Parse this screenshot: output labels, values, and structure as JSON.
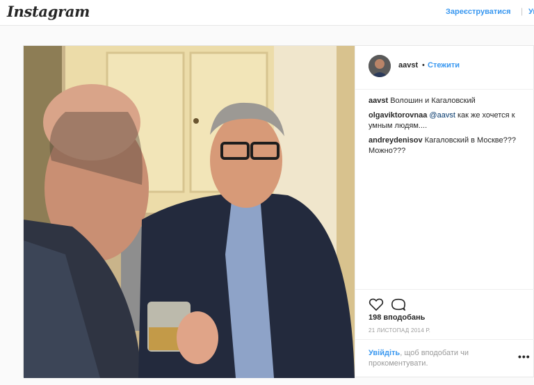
{
  "header": {
    "logo": "Instagram",
    "register_label": "Зареєструватися",
    "separator": "|",
    "login_label": "Увійти"
  },
  "post": {
    "photo_icon": "post-photo",
    "username": "aavst",
    "dot": "•",
    "follow_label": "Стежити",
    "comments": [
      {
        "user": "aavst",
        "mention": "",
        "text": "Волошин и Кагаловский"
      },
      {
        "user": "olgaviktorovnaa",
        "mention": "@aavst",
        "text": "как же хочется к умным людям...."
      },
      {
        "user": "andreydenisov",
        "mention": "",
        "text": "Кагаловский в Москве??? Можно???"
      }
    ],
    "likes": "198 вподобань",
    "date": "21 ЛИСТОПАД 2014 Р.",
    "login_prompt_link": "Увійдіть",
    "login_prompt_rest": ", щоб вподобати чи прокоментувати.",
    "more_label": "•••"
  }
}
